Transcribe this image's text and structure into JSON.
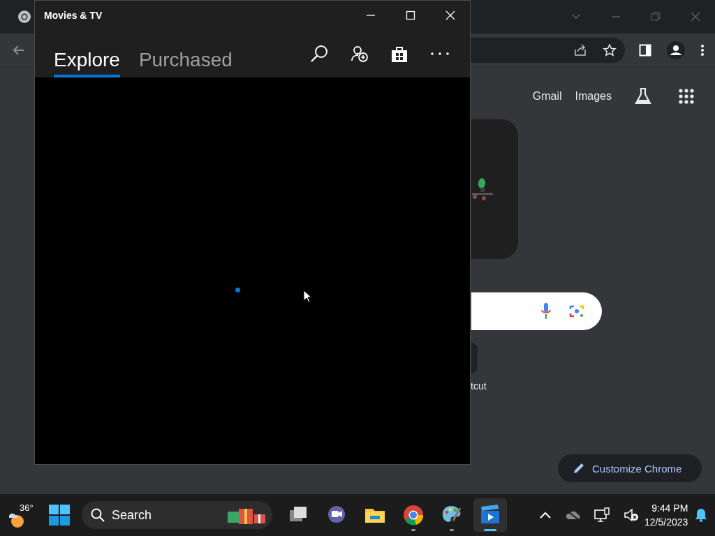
{
  "browser": {
    "header_links": [
      "Gmail",
      "Images"
    ],
    "shortcut_label": "tcut",
    "customize_button": "Customize Chrome"
  },
  "app_window": {
    "title": "Movies & TV",
    "tabs": [
      {
        "label": "Explore",
        "selected": true
      },
      {
        "label": "Purchased",
        "selected": false
      }
    ]
  },
  "taskbar": {
    "weather": "36°",
    "search": {
      "placeholder": "Search"
    },
    "apps": [
      {
        "kind": "task-view",
        "running": false,
        "active": false
      },
      {
        "kind": "chat",
        "running": false,
        "active": false
      },
      {
        "kind": "files",
        "running": false,
        "active": false
      },
      {
        "kind": "browser",
        "running": true,
        "active": false
      },
      {
        "kind": "paint",
        "running": true,
        "active": false
      },
      {
        "kind": "movies",
        "running": true,
        "active": true
      }
    ],
    "time": "9:44 PM",
    "date": "12/5/2023"
  }
}
